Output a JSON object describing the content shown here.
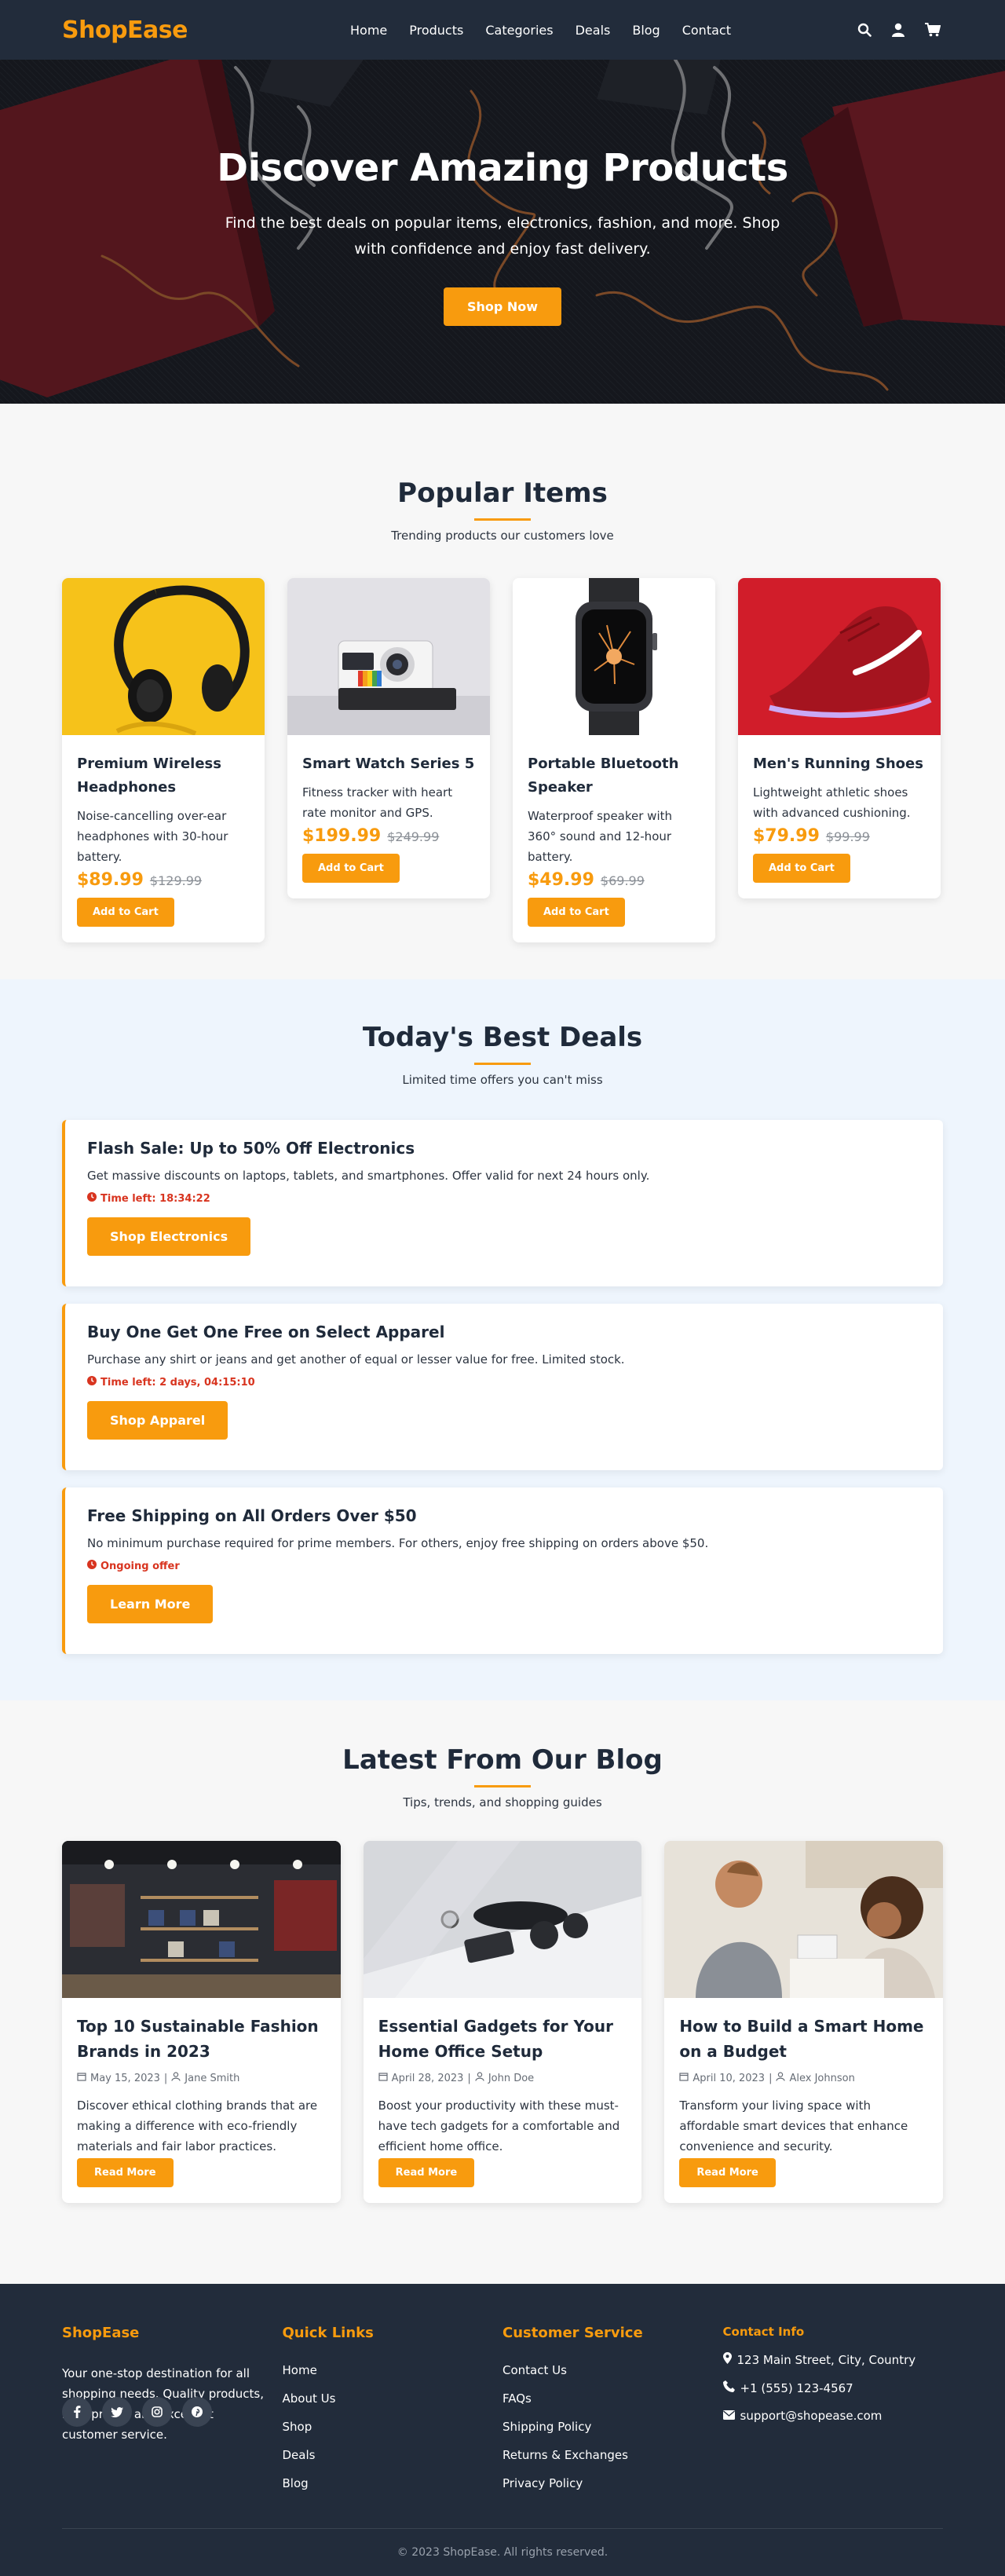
{
  "nav": {
    "brand": "ShopEase",
    "links": [
      "Home",
      "Products",
      "Categories",
      "Deals",
      "Blog",
      "Contact"
    ],
    "icons": [
      "search-icon",
      "user-icon",
      "cart-icon"
    ]
  },
  "hero": {
    "title": "Discover Amazing Products",
    "subtitle": "Find the best deals on popular items, electronics, fashion, and more. Shop with confidence and enjoy fast delivery.",
    "cta": "Shop Now"
  },
  "popular": {
    "title": "Popular Items",
    "subtitle": "Trending products our customers love",
    "items": [
      {
        "name": "Premium Wireless Headphones",
        "desc": "Noise-cancelling over-ear headphones with 30-hour battery.",
        "price": "$89.99",
        "old_price": "$129.99",
        "button": "Add to Cart"
      },
      {
        "name": "Smart Watch Series 5",
        "desc": "Fitness tracker with heart rate monitor and GPS.",
        "price": "$199.99",
        "old_price": "$249.99",
        "button": "Add to Cart"
      },
      {
        "name": "Portable Bluetooth Speaker",
        "desc": "Waterproof speaker with 360° sound and 12-hour battery.",
        "price": "$49.99",
        "old_price": "$69.99",
        "button": "Add to Cart"
      },
      {
        "name": "Men's Running Shoes",
        "desc": "Lightweight athletic shoes with advanced cushioning.",
        "price": "$79.99",
        "old_price": "$99.99",
        "button": "Add to Cart"
      }
    ]
  },
  "deals": {
    "title": "Today's Best Deals",
    "subtitle": "Limited time offers you can't miss",
    "items": [
      {
        "title": "Flash Sale: Up to 50% Off Electronics",
        "desc": "Get massive discounts on laptops, tablets, and smartphones. Offer valid for next 24 hours only.",
        "time": "Time left: 18:34:22",
        "button": "Shop Electronics"
      },
      {
        "title": "Buy One Get One Free on Select Apparel",
        "desc": "Purchase any shirt or jeans and get another of equal or lesser value for free. Limited stock.",
        "time": "Time left: 2 days, 04:15:10",
        "button": "Shop Apparel"
      },
      {
        "title": "Free Shipping on All Orders Over $50",
        "desc": "No minimum purchase required for prime members. For others, enjoy free shipping on orders above $50.",
        "time": "Ongoing offer",
        "button": "Learn More"
      }
    ]
  },
  "blog": {
    "title": "Latest From Our Blog",
    "subtitle": "Tips, trends, and shopping guides",
    "posts": [
      {
        "title": "Top 10 Sustainable Fashion Brands in 2023",
        "date": "May 15, 2023",
        "author": "Jane Smith",
        "desc": "Discover ethical clothing brands that are making a difference with eco-friendly materials and fair labor practices.",
        "button": "Read More"
      },
      {
        "title": "Essential Gadgets for Your Home Office Setup",
        "date": "April 28, 2023",
        "author": "John Doe",
        "desc": "Boost your productivity with these must-have tech gadgets for a comfortable and efficient home office.",
        "button": "Read More"
      },
      {
        "title": "How to Build a Smart Home on a Budget",
        "date": "April 10, 2023",
        "author": "Alex Johnson",
        "desc": "Transform your living space with affordable smart devices that enhance convenience and security.",
        "button": "Read More"
      }
    ]
  },
  "footer": {
    "about_title": "ShopEase",
    "about_text": "Your one-stop destination for all shopping needs. Quality products, best prices, and excellent customer service.",
    "social_icons": [
      "facebook-icon",
      "twitter-icon",
      "instagram-icon",
      "pinterest-icon"
    ],
    "quick_title": "Quick Links",
    "quick_links": [
      "Home",
      "About Us",
      "Shop",
      "Deals",
      "Blog"
    ],
    "service_title": "Customer Service",
    "service_links": [
      "Contact Us",
      "FAQs",
      "Shipping Policy",
      "Returns & Exchanges",
      "Privacy Policy"
    ],
    "contact_title": "Contact Info",
    "address": "123 Main Street, City, Country",
    "phone": "+1 (555) 123-4567",
    "email": "support@shopease.com",
    "copyright": "© 2023 ShopEase. All rights reserved."
  },
  "colors": {
    "accent": "#f89b0e",
    "navy": "#222c3b",
    "urgent": "#d8341f",
    "deals_bg": "#eef5fd"
  }
}
